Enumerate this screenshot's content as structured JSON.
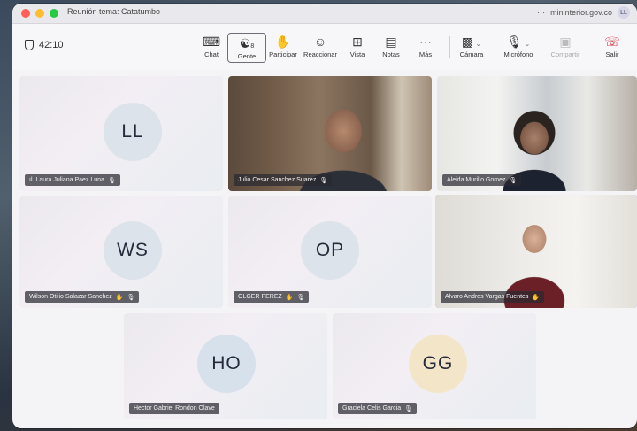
{
  "window": {
    "title": "Reunión tema: Catatumbo",
    "domain": "mininterior.gov.co",
    "user_initials": "LL",
    "more": "···"
  },
  "meeting": {
    "timer": "42:10"
  },
  "toolbar": {
    "chat": "Chat",
    "people": "Gente",
    "people_count": "8",
    "raise_hand": "Participar",
    "react": "Reaccionar",
    "view": "Vista",
    "notes": "Notas",
    "more": "Más",
    "camera": "Cámara",
    "mic": "Micrófono",
    "share": "Compartir",
    "leave": "Salir"
  },
  "participants": [
    {
      "name": "Laura Juliana Paez Luna",
      "initials": "LL",
      "avatar_color": "#dde3ea",
      "video": false,
      "muted": true,
      "signal_prefix": "ıl"
    },
    {
      "name": "Julio Cesar Sanchez Suarez",
      "video": true,
      "muted": true
    },
    {
      "name": "Aleida Murillo Gomez",
      "video": true,
      "muted": true
    },
    {
      "name": "Wilson Otilio Salazar Sanchez",
      "initials": "WS",
      "avatar_color": "#dde3ea",
      "video": false,
      "muted": true,
      "hand_icon": true
    },
    {
      "name": "OLGER PEREZ",
      "initials": "OP",
      "avatar_color": "#dde3ea",
      "video": false,
      "muted": true,
      "hand_icon": true
    },
    {
      "name": "Alvaro Andres Vargas Fuentes",
      "video": true,
      "speaking": true,
      "hand_icon": true
    },
    {
      "name": "Hector Gabriel Rondon Olave",
      "initials": "HO",
      "avatar_color": "#d6e1ec",
      "video": false
    },
    {
      "name": "Graciela Celis Garcia",
      "initials": "GG",
      "avatar_color": "#f3e6c8",
      "video": false,
      "muted": true
    }
  ]
}
